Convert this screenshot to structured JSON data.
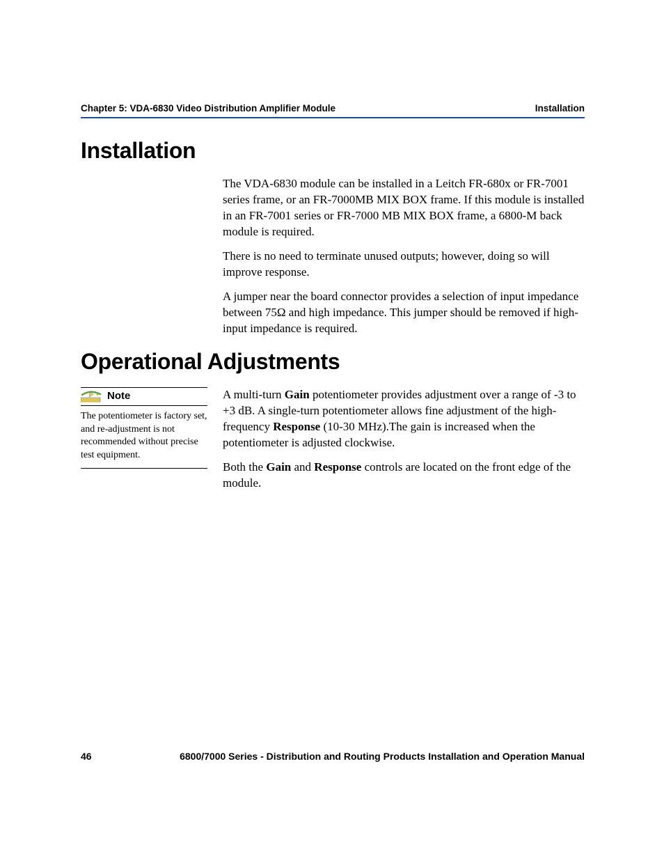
{
  "header": {
    "left": "Chapter 5: VDA-6830 Video Distribution Amplifier Module",
    "right": "Installation"
  },
  "section1": {
    "title": "Installation",
    "p1": "The VDA-6830 module can be installed in a Leitch FR-680x or FR-7001 series frame, or an FR-7000MB MIX BOX frame. If this module is installed in an FR-7001 series or FR-7000 MB MIX BOX frame, a 6800-M back module is required.",
    "p2": "There is no need to terminate unused outputs; however, doing so will improve response.",
    "p3": "A jumper near the board connector provides a selection of input impedance between 75Ω and high impedance. This jumper should be removed if high-input impedance is required."
  },
  "section2": {
    "title": "Operational Adjustments",
    "note_label": "Note",
    "note_text": "The potentiometer is factory set, and re-adjustment is not recommended without precise test equipment.",
    "p1_a": "A multi-turn ",
    "p1_b": "Gain",
    "p1_c": " potentiometer provides adjustment over a range of -3 to +3 dB. A single-turn potentiometer allows fine adjustment of the high-frequency ",
    "p1_d": "Response",
    "p1_e": " (10-30 MHz).The gain is increased when the potentiometer is adjusted clockwise.",
    "p2_a": "Both the ",
    "p2_b": "Gain",
    "p2_c": " and ",
    "p2_d": "Response",
    "p2_e": " controls are located on the front edge of the module."
  },
  "footer": {
    "page": "46",
    "title": "6800/7000 Series - Distribution and Routing Products Installation and Operation Manual"
  }
}
